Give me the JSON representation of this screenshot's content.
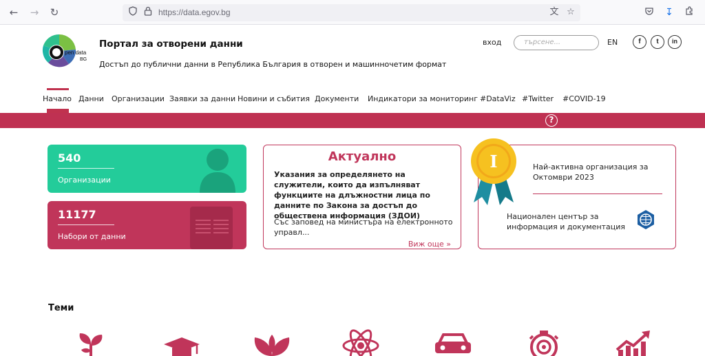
{
  "browser": {
    "url": "https://data.egov.bg"
  },
  "header": {
    "logo_text_1": "pen data",
    "logo_text_2": "BG",
    "title": "Портал за отворени данни",
    "subtitle": "Достъп до публични данни в Република България в отворен и машинночетим формат",
    "login": "вход",
    "search_placeholder": "търсене...",
    "language": "EN",
    "social": [
      "f",
      "t",
      "in"
    ]
  },
  "nav": {
    "items": [
      {
        "label": "Начало",
        "active": true
      },
      {
        "label": "Данни"
      },
      {
        "label": "Организации"
      },
      {
        "label": "Заявки за данни"
      },
      {
        "label": "Новини и събития"
      },
      {
        "label": "Документи"
      },
      {
        "label": "Индикатори за мониторинг"
      },
      {
        "label": "#DataViz"
      },
      {
        "label": "#Twitter"
      },
      {
        "label": "#COVID-19"
      }
    ],
    "help": "?"
  },
  "stats": {
    "orgs": {
      "value": "540",
      "label": "Организации"
    },
    "datasets": {
      "value": "11177",
      "label": "Набори от данни"
    }
  },
  "news": {
    "heading": "Актуално",
    "title": "Указания за определянето на служители, които да изпълняват функциите на длъжностни лица по данните по Закона за достъп до обществена информация (ЗДОИ)",
    "body": "Със заповед на министъра на електронното управл...",
    "more": "Виж още »"
  },
  "active_org": {
    "heading": "Най-активна организация за Октомври 2023",
    "name": "Национален център за информация и документация",
    "medal": "I"
  },
  "topics": {
    "title": "Теми",
    "icons": [
      "leaf-sprout-icon",
      "graduation-cap-icon",
      "leaves-icon",
      "atom-icon",
      "car-icon",
      "stopwatch-gear-icon",
      "growth-chart-icon"
    ]
  },
  "colors": {
    "crimson": "#c0355a",
    "green": "#23cc9a"
  }
}
